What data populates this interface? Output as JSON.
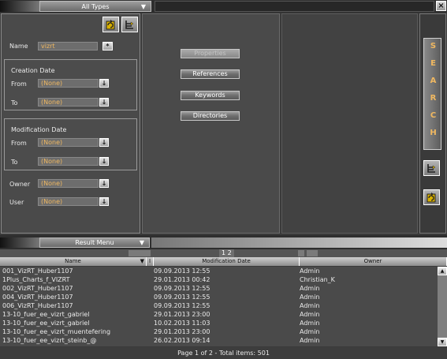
{
  "header": {
    "type_filter": "All Types",
    "close_label": "×"
  },
  "search_form": {
    "name_label": "Name",
    "name_value": "vizrt",
    "name_wildcard": "*",
    "creation_title": "Creation Date",
    "modification_title": "Modification Date",
    "from_label": "From",
    "to_label": "To",
    "owner_label": "Owner",
    "user_label": "User",
    "none_value": "(None)"
  },
  "filter_buttons": {
    "properties": "Properties",
    "references": "References",
    "keywords": "Keywords",
    "directories": "Directories"
  },
  "search_button": {
    "letters": [
      "S",
      "E",
      "A",
      "R",
      "C",
      "H"
    ]
  },
  "results": {
    "menu_label": "Result Menu",
    "pages": "1 2",
    "columns": {
      "name": "Name",
      "flag": "I",
      "date": "Modification Date",
      "owner": "Owner"
    },
    "rows": [
      {
        "name": "001_VizRT_Huber1107",
        "date": "09.09.2013 12:55",
        "owner": "Admin"
      },
      {
        "name": "1Plus_Charts_f_VIZRT",
        "date": "29.01.2013 00:42",
        "owner": "Christian_K"
      },
      {
        "name": "002_VizRT_Huber1107",
        "date": "09.09.2013 12:55",
        "owner": "Admin"
      },
      {
        "name": "004_VizRT_Huber1107",
        "date": "09.09.2013 12:55",
        "owner": "Admin"
      },
      {
        "name": "006_VizRT_Huber1107",
        "date": "09.09.2013 12:55",
        "owner": "Admin"
      },
      {
        "name": "13-10_fuer_ee_vizrt_gabriel",
        "date": "29.01.2013 23:00",
        "owner": "Admin"
      },
      {
        "name": "13-10_fuer_ee_vizrt_gabriel",
        "date": "10.02.2013 11:03",
        "owner": "Admin"
      },
      {
        "name": "13-10_fuer_ee_vizrt_muentefering",
        "date": "29.01.2013 23:00",
        "owner": "Admin"
      },
      {
        "name": "13-10_fuer_ee_vizrt_steinb_@",
        "date": "26.02.2013 09:14",
        "owner": "Admin"
      }
    ],
    "status": "Page 1 of 2 - Total items: 501"
  },
  "colors": {
    "accent_text": "#f0b860",
    "panel_bg": "#4a4a4a"
  }
}
